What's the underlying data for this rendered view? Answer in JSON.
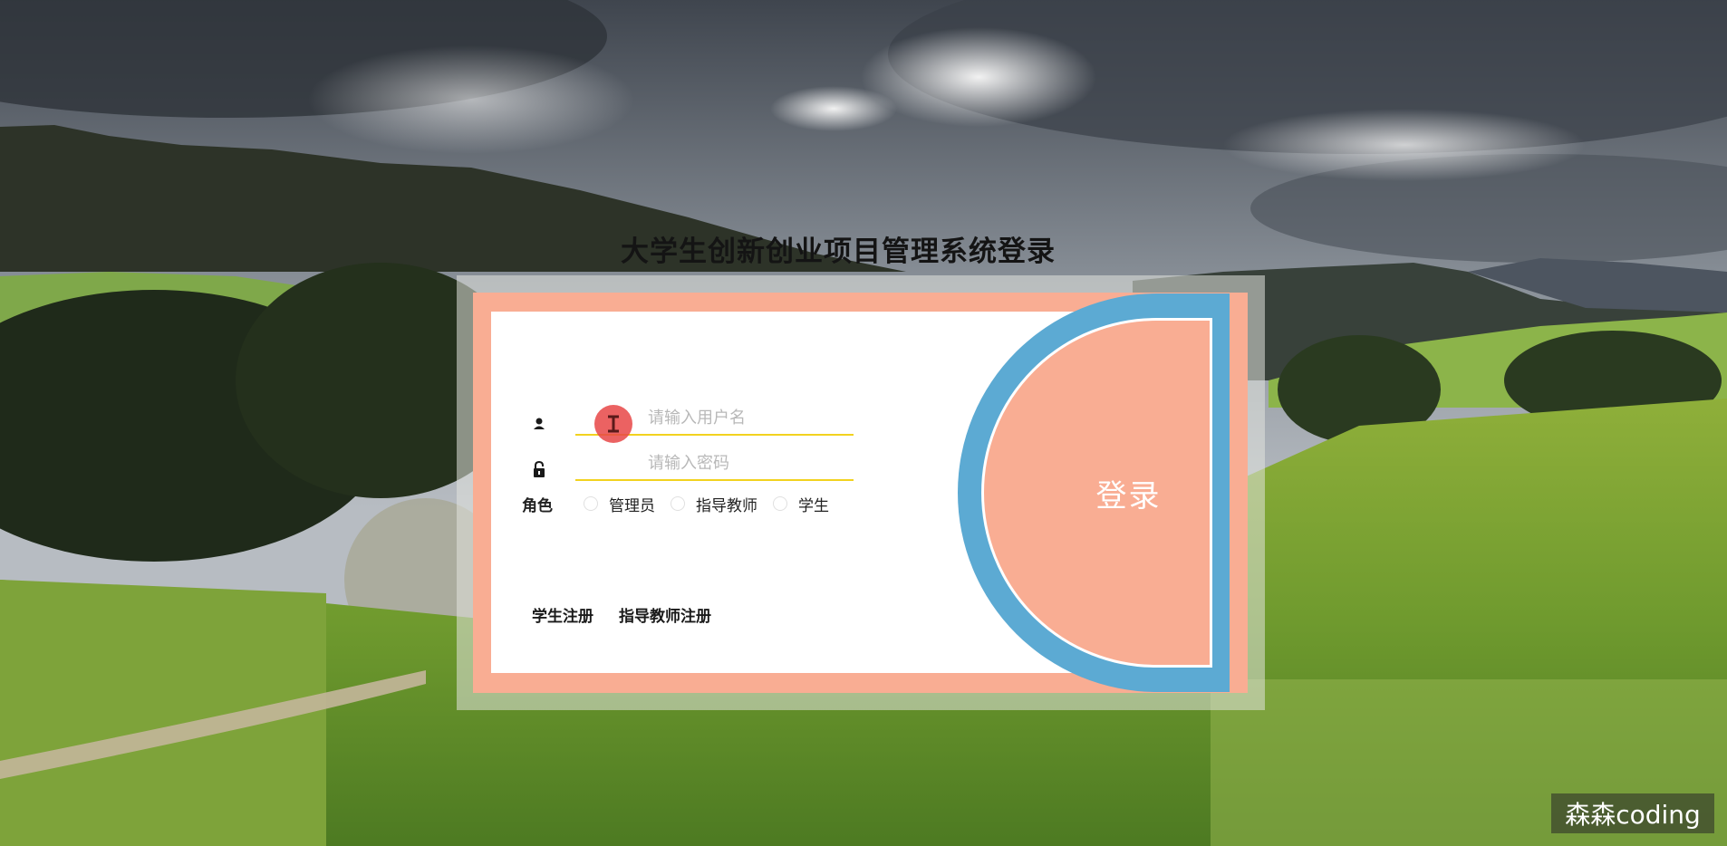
{
  "page": {
    "title": "大学生创新创业项目管理系统登录"
  },
  "form": {
    "username_placeholder": "请输入用户名",
    "password_placeholder": "请输入密码",
    "role_label": "角色",
    "roles": [
      "管理员",
      "指导教师",
      "学生"
    ],
    "login_label": "登录"
  },
  "register": {
    "student": "学生注册",
    "teacher": "指导教师注册"
  },
  "icons": {
    "username": "user-icon",
    "password": "lock-icon",
    "cursor": "text-cursor-icon"
  },
  "colors": {
    "card": "#f9ad93",
    "arc": "#5caad3",
    "underline": "#f2d21f"
  },
  "watermark": "森森coding"
}
